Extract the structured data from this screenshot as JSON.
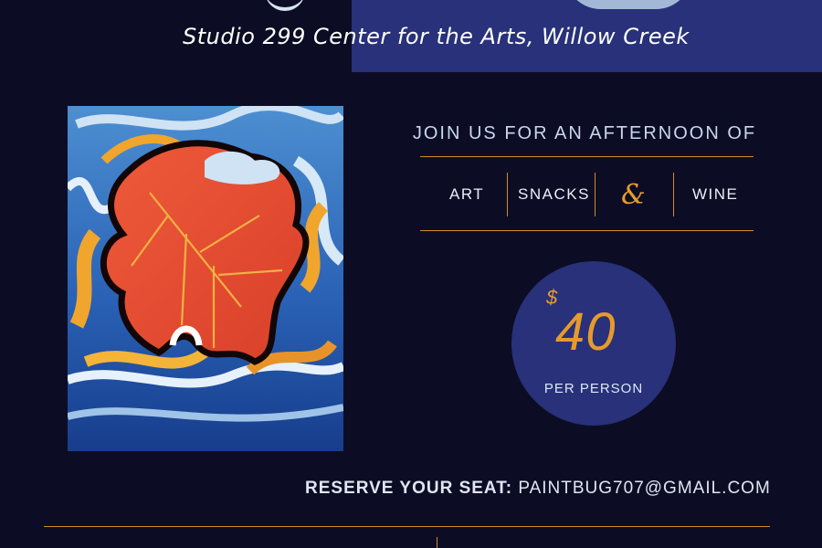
{
  "event": {
    "venue": "Studio 299 Center for the Arts, Willow Creek"
  },
  "invite": {
    "headline": "JOIN US FOR AN AFTERNOON OF",
    "offerings": [
      "ART",
      "SNACKS",
      "&",
      "WINE"
    ]
  },
  "price": {
    "currency": "$",
    "amount": "40",
    "unit": "PER PERSON"
  },
  "reservation": {
    "label": "RESERVE YOUR SEAT:",
    "email": "PAINTBUG707@GMAIL.COM"
  },
  "colors": {
    "background": "#0c0d24",
    "band": "#283179",
    "accent": "#e69a2e",
    "rule": "#d08a2a"
  }
}
